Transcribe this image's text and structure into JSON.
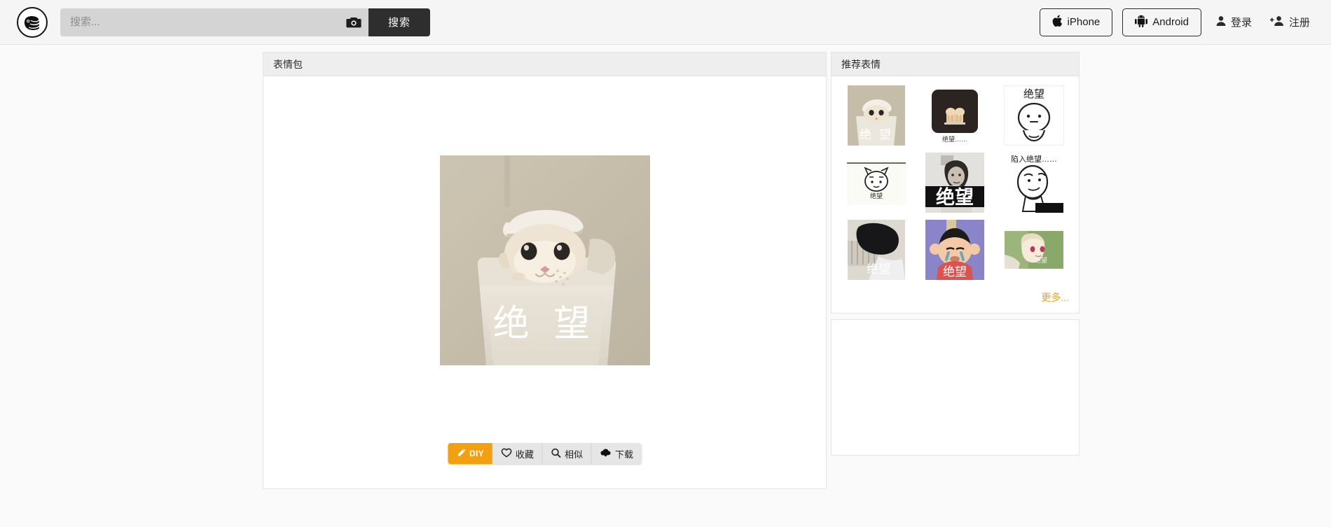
{
  "header": {
    "logo_icon": "doutu-logo-icon",
    "search": {
      "placeholder": "搜索...",
      "value": "",
      "camera_icon": "camera-icon",
      "button_label": "搜索"
    },
    "apps": [
      {
        "label": "iPhone",
        "icon": "apple-icon"
      },
      {
        "label": "Android",
        "icon": "android-icon"
      }
    ],
    "account": [
      {
        "label": "登录",
        "icon": "user-icon"
      },
      {
        "label": "注册",
        "icon": "user-plus-icon"
      }
    ]
  },
  "main": {
    "panel_title": "表情包",
    "hero": {
      "caption": "绝 望",
      "alt": "绝望"
    },
    "actions": [
      {
        "label": "DIY",
        "icon": "pencil-icon",
        "primary": true
      },
      {
        "label": "收藏",
        "icon": "heart-icon",
        "primary": false
      },
      {
        "label": "相似",
        "icon": "magnifier-icon",
        "primary": false
      },
      {
        "label": "下载",
        "icon": "download-cloud-icon",
        "primary": false
      }
    ]
  },
  "sidebar": {
    "panel_title": "推荐表情",
    "thumbnails": [
      {
        "caption": "绝 望",
        "style": "cat-bin"
      },
      {
        "caption": "绝望……",
        "style": "dark-bread"
      },
      {
        "caption": "绝望",
        "style": "sketch-blob"
      },
      {
        "caption": "绝望",
        "style": "line-cat"
      },
      {
        "caption": "绝望",
        "style": "bw-girl"
      },
      {
        "caption": "陷入绝望……",
        "style": "sketch-think"
      },
      {
        "caption": "绝望",
        "style": "black-cat"
      },
      {
        "caption": "绝望",
        "style": "crying-man"
      },
      {
        "caption": "绝望",
        "style": "anime-girl"
      }
    ],
    "more_label": "更多..."
  },
  "colors": {
    "accent": "#f2a012",
    "header_bg": "#f5f5f5",
    "panel_head_bg": "#eeeeee",
    "page_bg": "#fafafa",
    "search_bg": "#d4d4d4",
    "search_btn_bg": "#2e2e2e"
  }
}
